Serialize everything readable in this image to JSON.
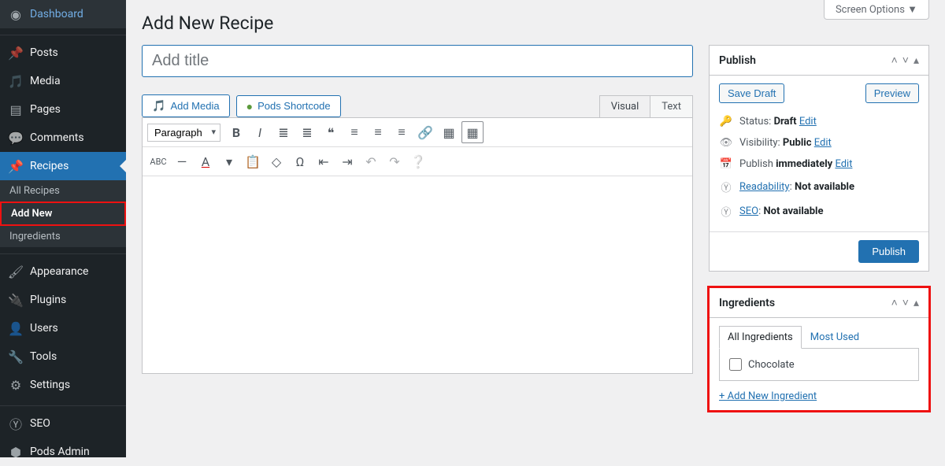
{
  "screen_options": "Screen Options  ▼",
  "page_title": "Add New Recipe",
  "title_placeholder": "Add title",
  "sidebar": {
    "dashboard": "Dashboard",
    "posts": "Posts",
    "media": "Media",
    "pages": "Pages",
    "comments": "Comments",
    "recipes": "Recipes",
    "sub_all": "All Recipes",
    "sub_add": "Add New",
    "sub_ing": "Ingredients",
    "appearance": "Appearance",
    "plugins": "Plugins",
    "users": "Users",
    "tools": "Tools",
    "settings": "Settings",
    "seo": "SEO",
    "pods": "Pods Admin"
  },
  "editor": {
    "add_media": "Add Media",
    "pods_shortcode": "Pods Shortcode",
    "tab_visual": "Visual",
    "tab_text": "Text",
    "format_select": "Paragraph"
  },
  "publish": {
    "title": "Publish",
    "save_draft": "Save Draft",
    "preview": "Preview",
    "status_label": "Status:",
    "status_value": "Draft",
    "visibility_label": "Visibility:",
    "visibility_value": "Public",
    "publish_label": "Publish",
    "publish_value": "immediately",
    "readability_label": "Readability",
    "na": "Not available",
    "seo_label": "SEO",
    "edit": "Edit",
    "button": "Publish"
  },
  "ingredients": {
    "title": "Ingredients",
    "tab_all": "All Ingredients",
    "tab_most": "Most Used",
    "item1": "Chocolate",
    "add_new": "+ Add New Ingredient"
  }
}
